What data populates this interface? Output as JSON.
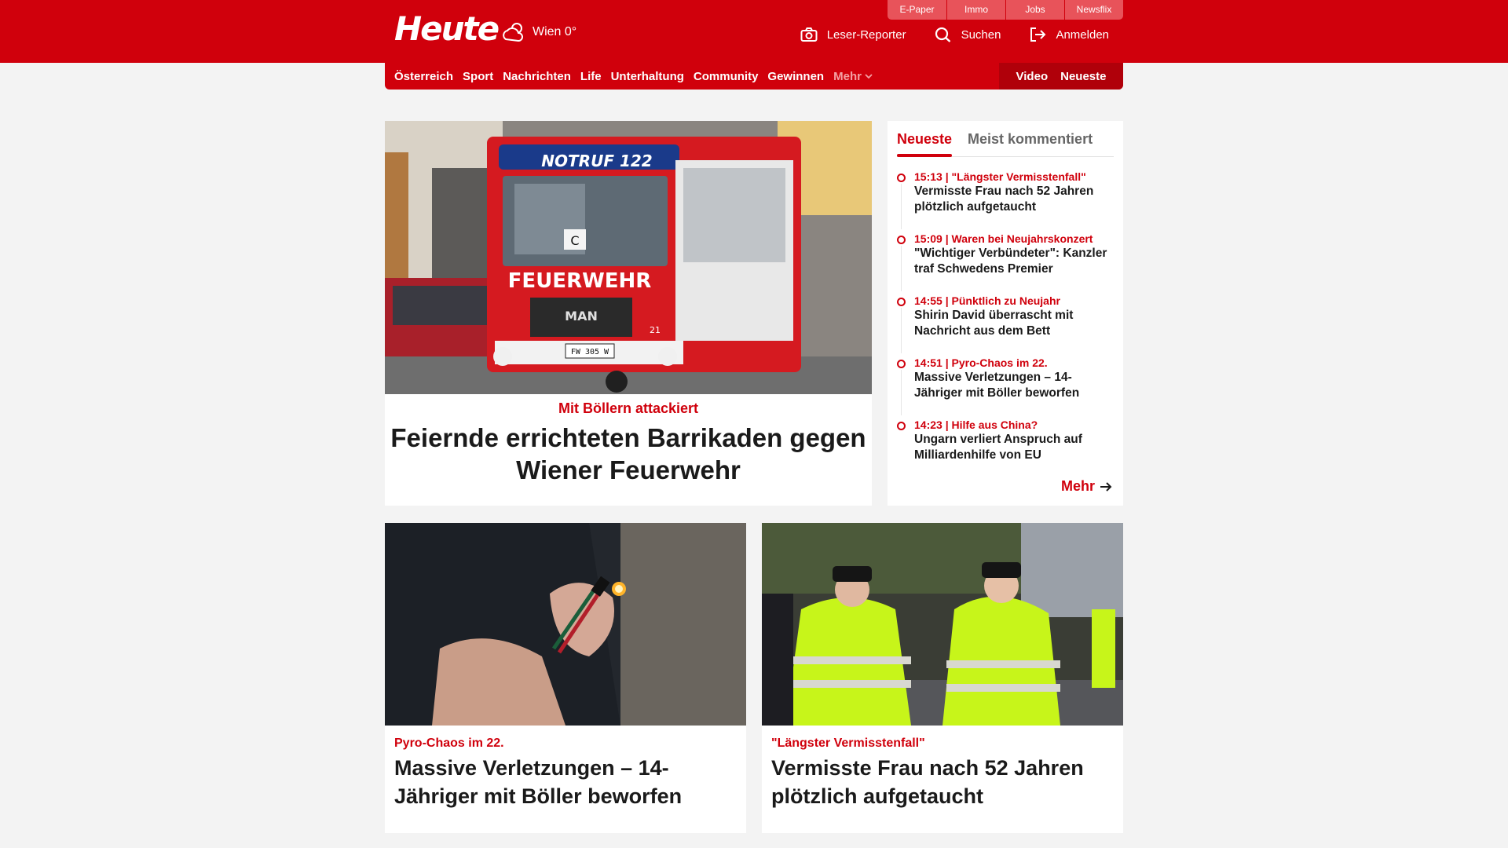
{
  "header": {
    "logo_text": "Heute",
    "weather_text": "Wien 0°",
    "top_links": [
      "E-Paper",
      "Immo",
      "Jobs",
      "Newsflix"
    ],
    "actions": {
      "reporter": "Leser-Reporter",
      "search": "Suchen",
      "login": "Anmelden"
    }
  },
  "nav": {
    "items": [
      "Österreich",
      "Sport",
      "Nachrichten",
      "Life",
      "Unterhaltung",
      "Community",
      "Gewinnen"
    ],
    "more": "Mehr",
    "video": "Video",
    "latest": "Neueste"
  },
  "hero": {
    "kicker": "Mit Böllern attackiert",
    "title": "Feiernde errichteten Barrikaden gegen Wiener Feuerwehr",
    "image_texts": {
      "sign_top": "NOTRUF 122",
      "sign_main": "FEUERWEHR",
      "brand": "MAN",
      "plate": "FW 305 W",
      "letter": "C",
      "unit": "21"
    }
  },
  "sidebar": {
    "tabs": [
      "Neueste",
      "Meist kommentiert"
    ],
    "items": [
      {
        "kicker": "15:13 | \"Längster Vermisstenfall\"",
        "title": "Vermisste Frau nach 52 Jahren plötzlich aufgetaucht"
      },
      {
        "kicker": "15:09 | Waren bei Neujahrskonzert",
        "title": "\"Wichtiger Verbündeter\": Kanzler traf Schwedens Premier"
      },
      {
        "kicker": "14:55 | Pünktlich zu Neujahr",
        "title": "Shirin David überrascht mit Nachricht aus dem Bett"
      },
      {
        "kicker": "14:51 | Pyro-Chaos im 22.",
        "title": "Massive Verletzungen – 14-Jähriger mit Böller beworfen"
      },
      {
        "kicker": "14:23 | Hilfe aus China?",
        "title": "Ungarn verliert Anspruch auf Milliardenhilfe von EU"
      }
    ],
    "more": "Mehr"
  },
  "cards": [
    {
      "kicker": "Pyro-Chaos im 22.",
      "title": "Massive Verletzungen – 14-Jähriger mit Böller beworfen"
    },
    {
      "kicker": "\"Längster Vermisstenfall\"",
      "title": "Vermisste Frau nach 52 Jahren plötzlich aufgetaucht"
    }
  ],
  "colors": {
    "brand_red": "#d0000c",
    "top_link_bg": "#e8535a",
    "page_bg": "#f3f3f3"
  }
}
